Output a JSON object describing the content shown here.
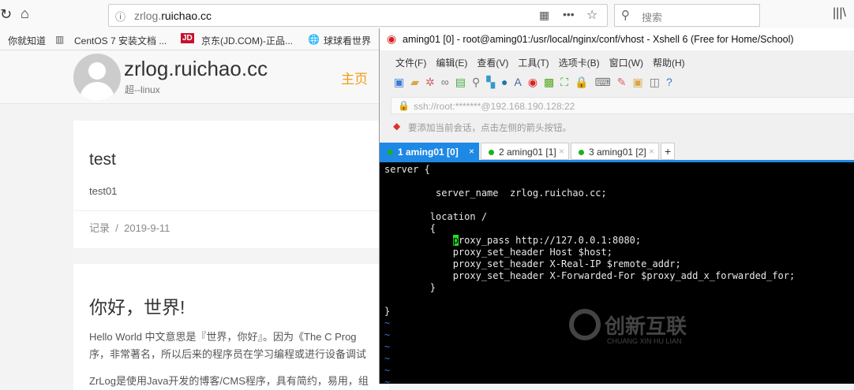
{
  "browser": {
    "url_prefix": "zrlog.",
    "url_domain": "ruichao.cc",
    "search_placeholder": "搜索",
    "bookmarks": [
      "你就知道",
      "CentOS 7 安装文档 ...",
      "京东(JD.COM)-正品...",
      "球球看世界"
    ],
    "jd_badge": "JD"
  },
  "site": {
    "title": "zrlog.ruichao.cc",
    "subtitle": "超--linux",
    "nav_home": "主页",
    "post1": {
      "title": "test",
      "body": "test01",
      "category": "记录",
      "sep": "/",
      "date": "2019-9-11"
    },
    "post2": {
      "title": "你好，世界!",
      "line1": "Hello World 中文意思是『世界，你好』。因为《The C Prog",
      "line2": "序，非常著名，所以后来的程序员在学习编程或进行设备调试",
      "line3": "ZrLog是使用Java开发的博客/CMS程序，具有简约，易用，组"
    }
  },
  "xshell": {
    "title": "aming01 [0] - root@aming01:/usr/local/nginx/conf/vhost - Xshell 6 (Free for Home/School)",
    "menu": [
      "文件(F)",
      "编辑(E)",
      "查看(V)",
      "工具(T)",
      "选项卡(B)",
      "窗口(W)",
      "帮助(H)"
    ],
    "address": "ssh://root:*******@192.168.190.128:22",
    "hint": "要添加当前会话，点击左侧的箭头按钮。",
    "tabs": [
      "1 aming01 [0]",
      "2 aming01 [1]",
      "3 aming01 [2]"
    ],
    "add_tab": "+",
    "terminal": [
      "server {",
      "",
      "         server_name  zrlog.ruichao.cc;",
      "",
      "        location /",
      "        {",
      "            proxy_pass http://127.0.0.1:8080;",
      "            proxy_set_header Host $host;",
      "            proxy_set_header X-Real-IP $remote_addr;",
      "            proxy_set_header X-Forwarded-For $proxy_add_x_forwarded_for;",
      "        }",
      "",
      "}",
      "~",
      "~",
      "~",
      "~",
      "~",
      "~"
    ],
    "watermark": "创新互联",
    "watermark_sub": "CHUANG XIN HU LIAN"
  }
}
